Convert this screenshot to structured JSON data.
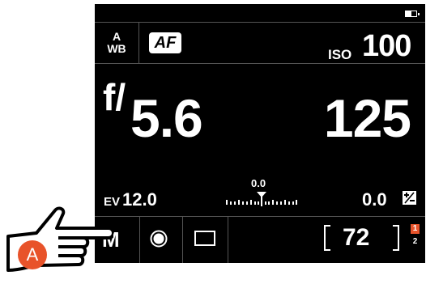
{
  "top": {
    "battery_icon": "battery-icon"
  },
  "info_row": {
    "wb_line1": "A",
    "wb_line2": "WB",
    "af_label": "AF",
    "iso_label": "ISO",
    "iso_value": "100"
  },
  "exposure": {
    "aperture_prefix": "f/",
    "aperture_value": "5.6",
    "shutter_value": "125"
  },
  "ev_row": {
    "ev_label": "EV",
    "ev_value": "12.0",
    "scale_value": "0.0",
    "exp_comp_value": "0.0",
    "exp_comp_icon": "plus-minus-icon"
  },
  "bottom": {
    "mode": "M",
    "metering_icon": "metering-icon",
    "frame_icon": "frame-icon",
    "shots_remaining": "72",
    "slot1": "1",
    "slot2": "2"
  },
  "callout": {
    "badge": "A",
    "badge_color": "#e8532a"
  }
}
